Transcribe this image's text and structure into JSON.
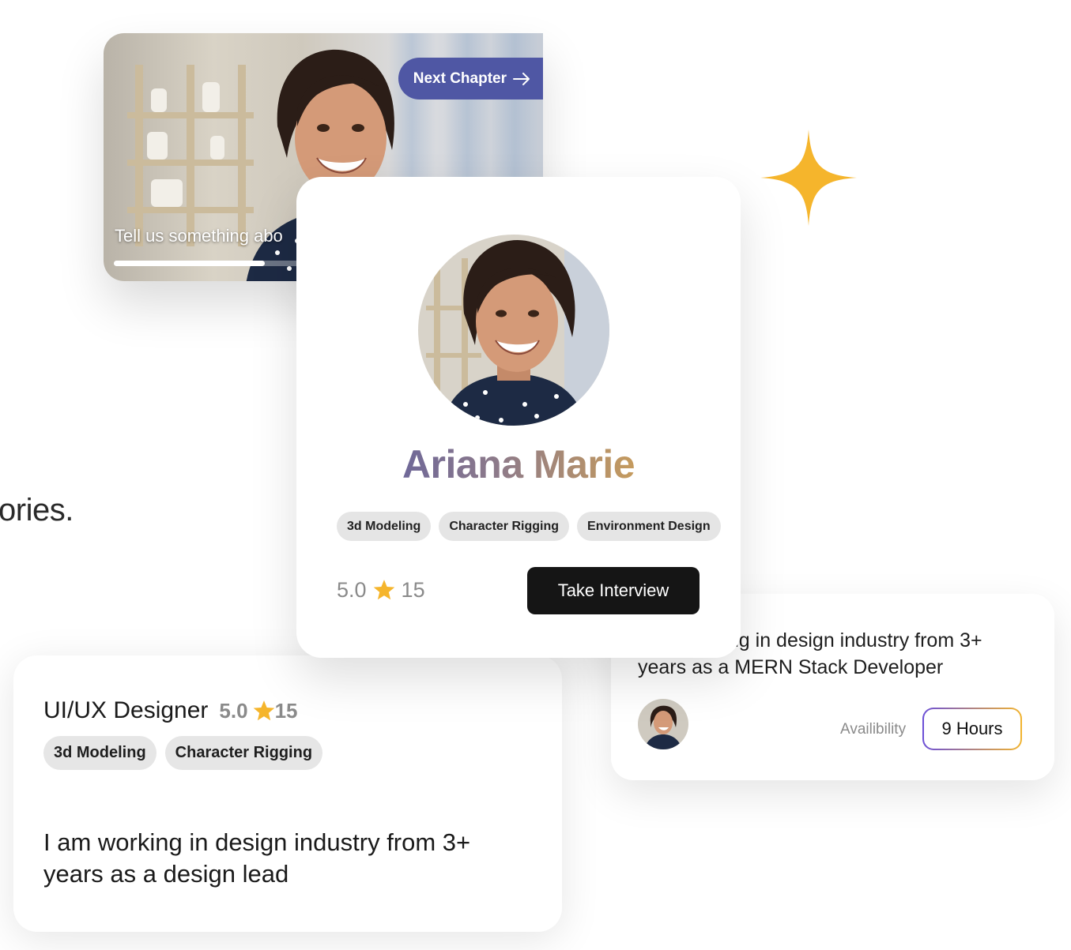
{
  "background": {
    "fragment_text": "ories."
  },
  "colors": {
    "accent_blue": "#4f57a4",
    "star": "#f5b52c",
    "name_gradient": [
      "#4e54a8",
      "#f0b43c"
    ]
  },
  "video_card": {
    "next_button_label": "Next Chapter",
    "caption": "Tell us something abo",
    "progress_percent": 36
  },
  "profile_card": {
    "name": "Ariana Marie",
    "tags": [
      "3d Modeling",
      "Character Rigging",
      "Environment Design"
    ],
    "rating": "5.0",
    "review_count": "15",
    "cta_label": "Take Interview"
  },
  "bio_card": {
    "bio": "I am working in design industry from 3+ years as a MERN Stack Developer",
    "availability_label": "Availibility",
    "availability_value": "9 Hours"
  },
  "designer_card": {
    "title": "UI/UX Designer",
    "rating": "5.0",
    "review_count": "15",
    "tags": [
      "3d Modeling",
      "Character Rigging"
    ],
    "bio": "I am working in design industry from 3+ years as a design lead"
  }
}
